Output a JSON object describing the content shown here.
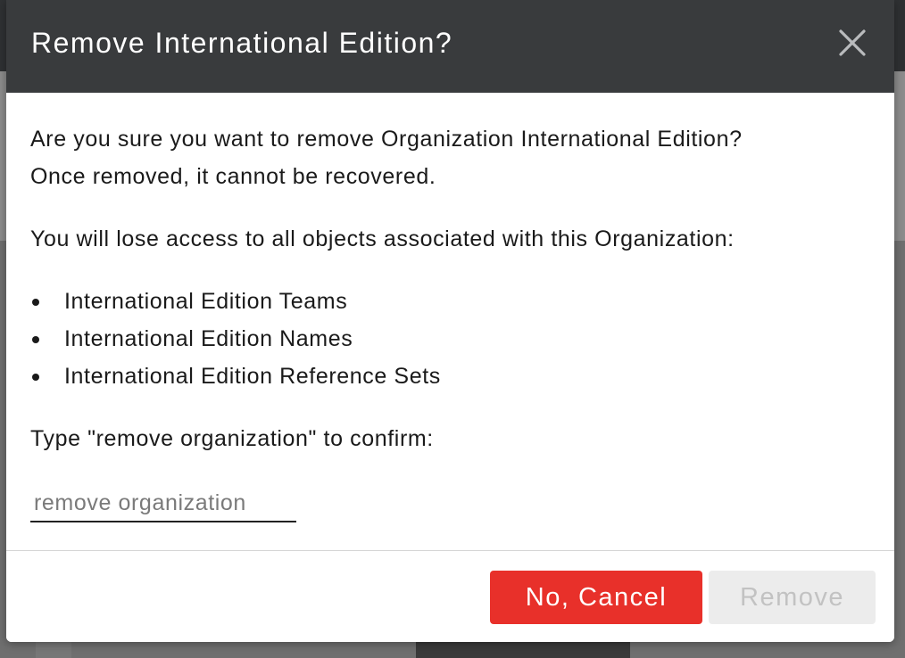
{
  "dialog": {
    "title": "Remove International Edition?",
    "intro_line_1": "Are you sure you want to remove Organization International Edition?",
    "intro_line_2": "Once removed, it cannot be recovered.",
    "lose_access_text": "You will lose access to all objects associated with this Organization:",
    "associated_objects": [
      "International Edition Teams",
      "International Edition Names",
      "International Edition Reference Sets"
    ],
    "confirm_prompt": "Type \"remove organization\" to confirm:",
    "confirm_input": {
      "value": "",
      "placeholder": "remove organization"
    },
    "cancel_button_label": "No, Cancel",
    "remove_button_label": "Remove",
    "remove_button_enabled": false
  },
  "icons": {
    "close": "close-icon"
  },
  "colors": {
    "header_bg": "#393b3d",
    "cancel_button_bg": "#e8302a",
    "remove_button_disabled_bg": "#ececec",
    "remove_button_disabled_text": "#c2c2c2"
  }
}
